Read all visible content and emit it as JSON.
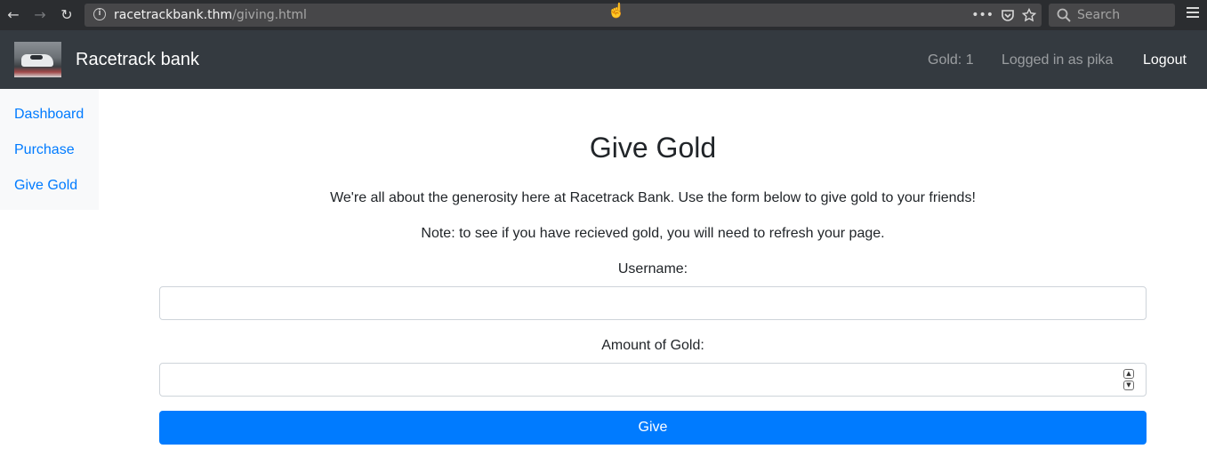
{
  "browser": {
    "url_host": "racetrackbank.thm",
    "url_path": "/giving.html",
    "search_placeholder": "Search",
    "back_icon": "arrow-left-icon",
    "forward_icon": "arrow-right-icon",
    "reload_icon": "reload-icon"
  },
  "navbar": {
    "brand": "Racetrack bank",
    "gold": "Gold: 1",
    "user": "Logged in as pika",
    "logout": "Logout"
  },
  "sidebar": {
    "items": [
      {
        "label": "Dashboard"
      },
      {
        "label": "Purchase"
      },
      {
        "label": "Give Gold"
      }
    ]
  },
  "main": {
    "title": "Give Gold",
    "intro": "We're all about the generosity here at Racetrack Bank. Use the form below to give gold to your friends!",
    "note": "Note: to see if you have recieved gold, you will need to refresh your page.",
    "username_label": "Username:",
    "username_value": "",
    "amount_label": "Amount of Gold:",
    "amount_value": "",
    "submit_label": "Give"
  },
  "colors": {
    "navbar_bg": "#343a40",
    "link": "#007bff",
    "button": "#007bff",
    "sidebar_bg": "#f8f9fa"
  }
}
